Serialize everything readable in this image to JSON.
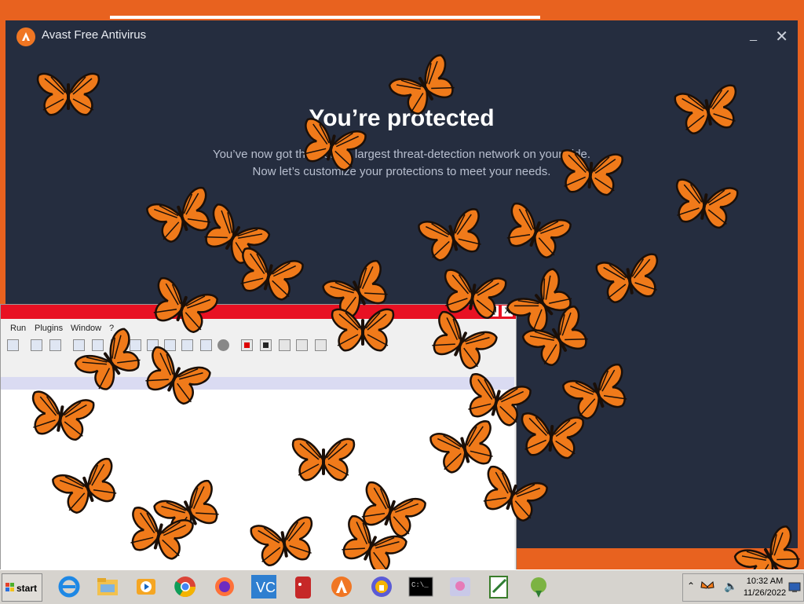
{
  "avast": {
    "window_title": "Avast Free Antivirus",
    "minimize": "_",
    "close": "✕",
    "heading": "You’re protected",
    "subtitle_line1": "You’ve now got the world’s largest threat-detection network on your side.",
    "subtitle_line2": "Now let’s customize your protections to meet your needs."
  },
  "editor": {
    "menus": [
      "Run",
      "Plugins",
      "Window",
      "?"
    ],
    "close_label": "X",
    "restore_label": "❐"
  },
  "taskbar": {
    "start_label": "start",
    "apps": [
      "internet-explorer",
      "file-explorer",
      "media-player",
      "chrome",
      "firefox",
      "visual-studio-code",
      "red-character",
      "avast",
      "secure-browser",
      "command-prompt",
      "image-viewer",
      "notepad-editor",
      "setup-tool"
    ],
    "clock_time": "10:32 AM",
    "clock_date": "11/26/2022"
  },
  "colors": {
    "desktop": "#e8621f",
    "avast_bg": "#252d3f",
    "butterfly_orange": "#f07a1a",
    "butterfly_black": "#1a0f08"
  }
}
